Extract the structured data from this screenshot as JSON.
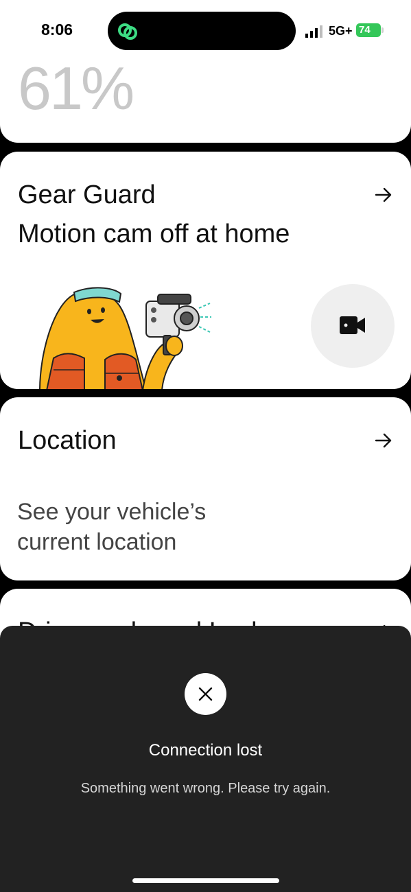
{
  "status_bar": {
    "time": "8:06",
    "network": "5G+",
    "battery": "74"
  },
  "battery_card": {
    "percent_text": "61%"
  },
  "gear_guard_card": {
    "title": "Gear Guard",
    "subtitle": "Motion cam off at home",
    "camera_button_icon": "video-camera-icon",
    "arrow_icon": "arrow-right-icon"
  },
  "location_card": {
    "title": "Location",
    "description": "See your vehicle’s current location",
    "arrow_icon": "arrow-right-icon"
  },
  "next_card": {
    "title": "Drive mode and Locks"
  },
  "error_sheet": {
    "icon": "close-icon",
    "title": "Connection lost",
    "message": "Something went wrong. Please try again."
  },
  "colors": {
    "battery_green": "#34c759",
    "sheet_background": "#222222",
    "island_icon_green": "#3ddc84"
  }
}
